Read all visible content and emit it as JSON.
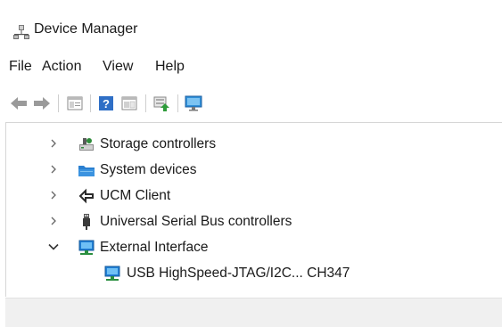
{
  "window": {
    "title": "Device Manager"
  },
  "menu": {
    "items": [
      {
        "label": "File"
      },
      {
        "label": "Action"
      },
      {
        "label": "View"
      },
      {
        "label": "Help"
      }
    ]
  },
  "toolbar": {
    "buttons": [
      {
        "icon": "back-arrow-icon"
      },
      {
        "icon": "forward-arrow-icon"
      },
      {
        "icon": "properties-icon"
      },
      {
        "icon": "help-icon"
      },
      {
        "icon": "properties-pane-icon"
      },
      {
        "icon": "update-driver-icon"
      },
      {
        "icon": "scan-hardware-icon"
      }
    ]
  },
  "tree": {
    "items": [
      {
        "label": "Storage controllers",
        "expanded": false,
        "icon": "storage-controller-icon"
      },
      {
        "label": "System devices",
        "expanded": false,
        "icon": "folder-icon"
      },
      {
        "label": "UCM Client",
        "expanded": false,
        "icon": "usb-c-icon"
      },
      {
        "label": "Universal Serial Bus controllers",
        "expanded": false,
        "icon": "usb-plug-icon"
      },
      {
        "label": "External Interface",
        "expanded": true,
        "icon": "monitor-network-icon"
      },
      {
        "label": "USB HighSpeed-JTAG/I2C... CH347",
        "child": true,
        "icon": "monitor-network-icon"
      }
    ]
  },
  "colors": {
    "accent": "#1a6fd1",
    "chevron": "#555555"
  }
}
